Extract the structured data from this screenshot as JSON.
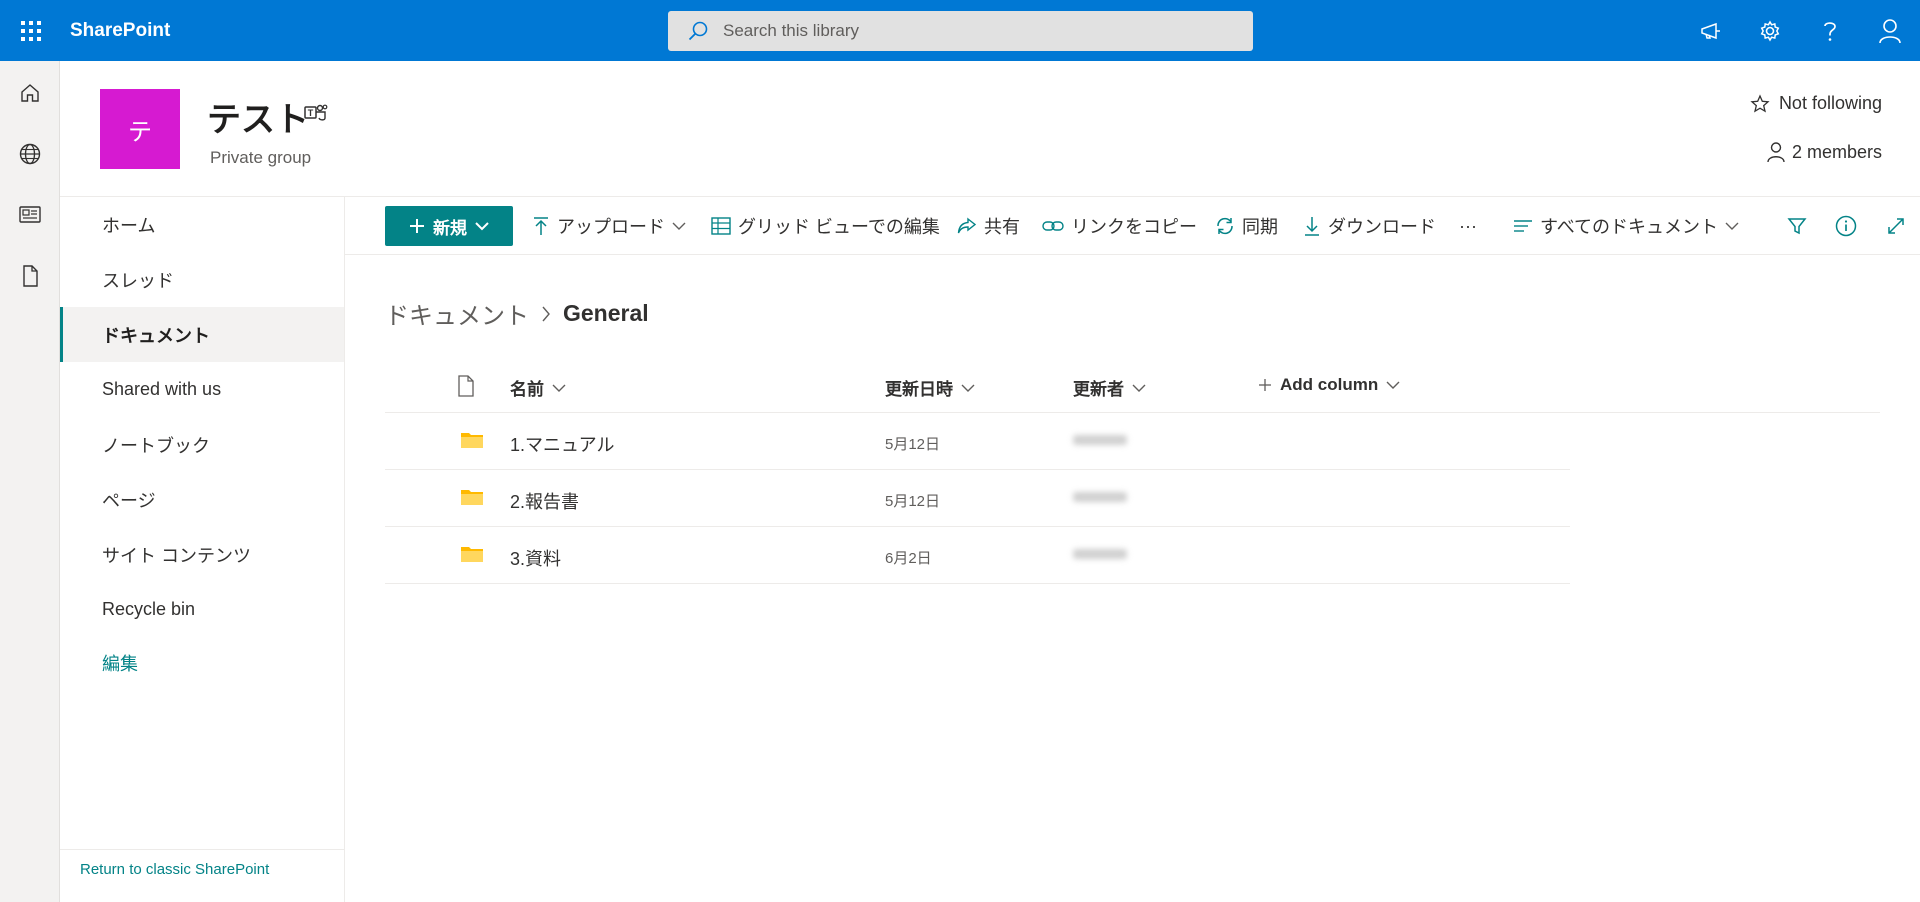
{
  "suitebar": {
    "brand": "SharePoint",
    "search_placeholder": "Search this library",
    "accent": "#0078d4"
  },
  "appbar": {
    "icons": [
      "home-icon",
      "globe-icon",
      "news-icon",
      "document-icon"
    ]
  },
  "site": {
    "logo_letter": "テ",
    "logo_color": "#d61ad1",
    "title": "テスト",
    "subtitle": "Private group",
    "follow_label": "Not following",
    "members_label": "2 members"
  },
  "leftnav": {
    "items": [
      {
        "label": "ホーム"
      },
      {
        "label": "スレッド"
      },
      {
        "label": "ドキュメント",
        "selected": true
      },
      {
        "label": "Shared with us"
      },
      {
        "label": "ノートブック"
      },
      {
        "label": "ページ"
      },
      {
        "label": "サイト コンテンツ"
      },
      {
        "label": "Recycle bin"
      }
    ],
    "edit_label": "編集",
    "classic_label": "Return to classic SharePoint",
    "accent": "#038387"
  },
  "commandbar": {
    "new_label": "新規",
    "upload_label": "アップロード",
    "grid_edit_label": "グリッド ビューでの編集",
    "share_label": "共有",
    "copy_link_label": "リンクをコピー",
    "sync_label": "同期",
    "download_label": "ダウンロード",
    "more_label": "···",
    "view_label": "すべてのドキュメント"
  },
  "breadcrumb": {
    "parent": "ドキュメント",
    "current": "General"
  },
  "list": {
    "columns": {
      "name": "名前",
      "modified": "更新日時",
      "modified_by": "更新者",
      "add_column": "Add column"
    },
    "rows": [
      {
        "name": "1.マニュアル",
        "modified": "5月12日"
      },
      {
        "name": "2.報告書",
        "modified": "5月12日"
      },
      {
        "name": "3.資料",
        "modified": "6月2日"
      }
    ]
  }
}
